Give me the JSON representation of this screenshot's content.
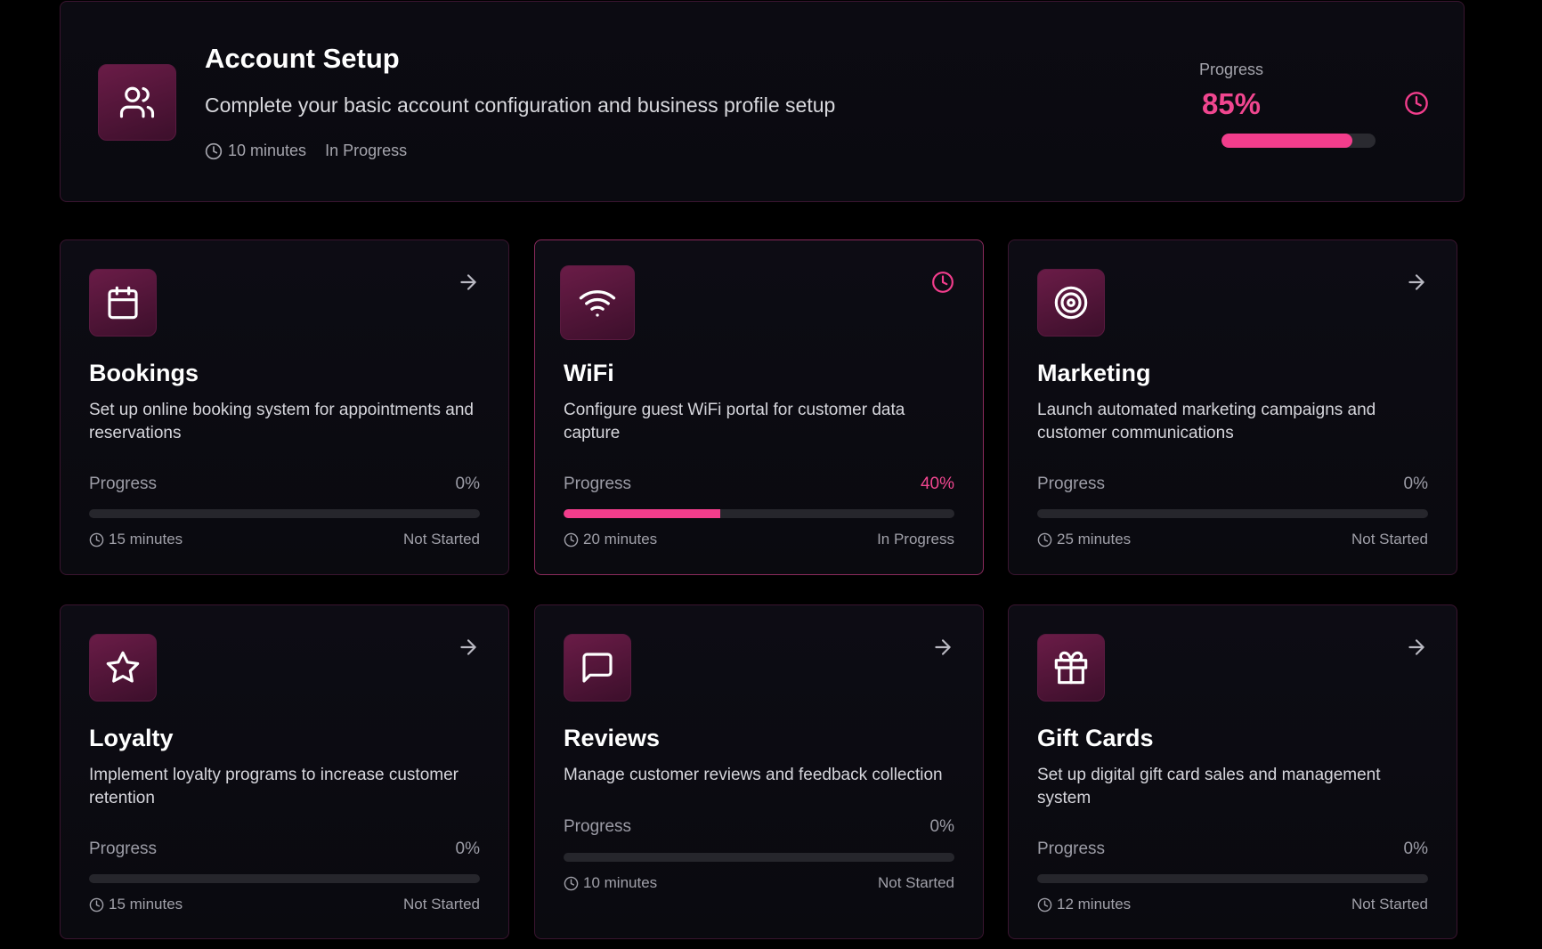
{
  "colors": {
    "accent": "#f23d8c",
    "tile": "#5c1840",
    "background": "#000000"
  },
  "header": {
    "icon": "users-icon",
    "title": "Account Setup",
    "description": "Complete your basic account configuration and business profile setup",
    "duration": "10 minutes",
    "status": "In Progress",
    "progress_label": "Progress",
    "progress_text": "85%",
    "progress_value": 85,
    "status_icon": "clock-icon"
  },
  "cards": [
    {
      "title": "Bookings",
      "icon": "calendar-icon",
      "corner_icon": "arrow-right-icon",
      "description": "Set up online booking system for appointments and reservations",
      "progress_label": "Progress",
      "progress_text": "0%",
      "progress_value": 0,
      "duration": "15 minutes",
      "status": "Not Started"
    },
    {
      "title": "WiFi",
      "icon": "wifi-icon",
      "corner_icon": "clock-icon",
      "description": "Configure guest WiFi portal for customer data capture",
      "progress_label": "Progress",
      "progress_text": "40%",
      "progress_value": 40,
      "duration": "20 minutes",
      "status": "In Progress"
    },
    {
      "title": "Marketing",
      "icon": "target-icon",
      "corner_icon": "arrow-right-icon",
      "description": "Launch automated marketing campaigns and customer communications",
      "progress_label": "Progress",
      "progress_text": "0%",
      "progress_value": 0,
      "duration": "25 minutes",
      "status": "Not Started"
    },
    {
      "title": "Loyalty",
      "icon": "star-icon",
      "corner_icon": "arrow-right-icon",
      "description": "Implement loyalty programs to increase customer retention",
      "progress_label": "Progress",
      "progress_text": "0%",
      "progress_value": 0,
      "duration": "15 minutes",
      "status": "Not Started"
    },
    {
      "title": "Reviews",
      "icon": "message-square-icon",
      "corner_icon": "arrow-right-icon",
      "description": "Manage customer reviews and feedback collection",
      "progress_label": "Progress",
      "progress_text": "0%",
      "progress_value": 0,
      "duration": "10 minutes",
      "status": "Not Started"
    },
    {
      "title": "Gift Cards",
      "icon": "gift-icon",
      "corner_icon": "arrow-right-icon",
      "description": "Set up digital gift card sales and management system",
      "progress_label": "Progress",
      "progress_text": "0%",
      "progress_value": 0,
      "duration": "12 minutes",
      "status": "Not Started"
    }
  ]
}
